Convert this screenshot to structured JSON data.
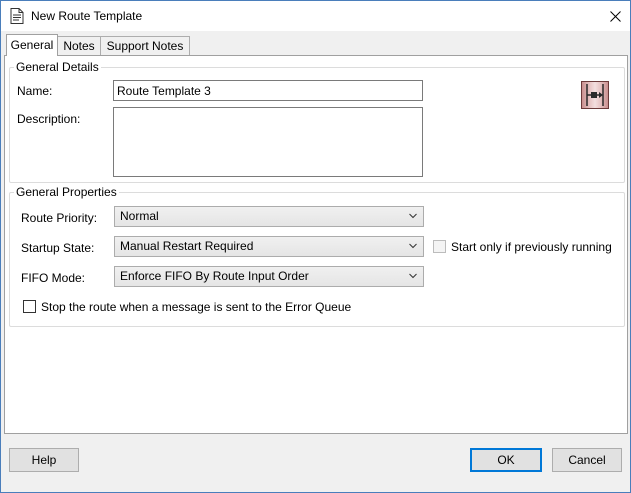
{
  "window": {
    "title": "New Route Template"
  },
  "tabs": [
    {
      "label": "General",
      "active": true
    },
    {
      "label": "Notes",
      "active": false
    },
    {
      "label": "Support Notes",
      "active": false
    }
  ],
  "general_details": {
    "title": "General Details",
    "name_label": "Name:",
    "name_value": "Route Template 3",
    "description_label": "Description:",
    "description_value": ""
  },
  "general_properties": {
    "title": "General Properties",
    "route_priority_label": "Route Priority:",
    "route_priority_value": "Normal",
    "startup_state_label": "Startup State:",
    "startup_state_value": "Manual Restart Required",
    "start_only_label": "Start only if previously running",
    "start_only_checked": false,
    "fifo_mode_label": "FIFO Mode:",
    "fifo_mode_value": "Enforce FIFO By Route Input Order",
    "stop_route_label": "Stop the route when a message is sent to the Error Queue",
    "stop_route_checked": false
  },
  "footer": {
    "help_label": "Help",
    "ok_label": "OK",
    "cancel_label": "Cancel"
  },
  "icons": {
    "app": "document-icon",
    "close": "close-icon",
    "route": "route-template-icon",
    "dropdown": "chevron-down-icon"
  },
  "colors": {
    "default_button_border": "#0078d7",
    "window_border": "#4a7ebb",
    "route_icon_frame": "#6b3a3a"
  }
}
